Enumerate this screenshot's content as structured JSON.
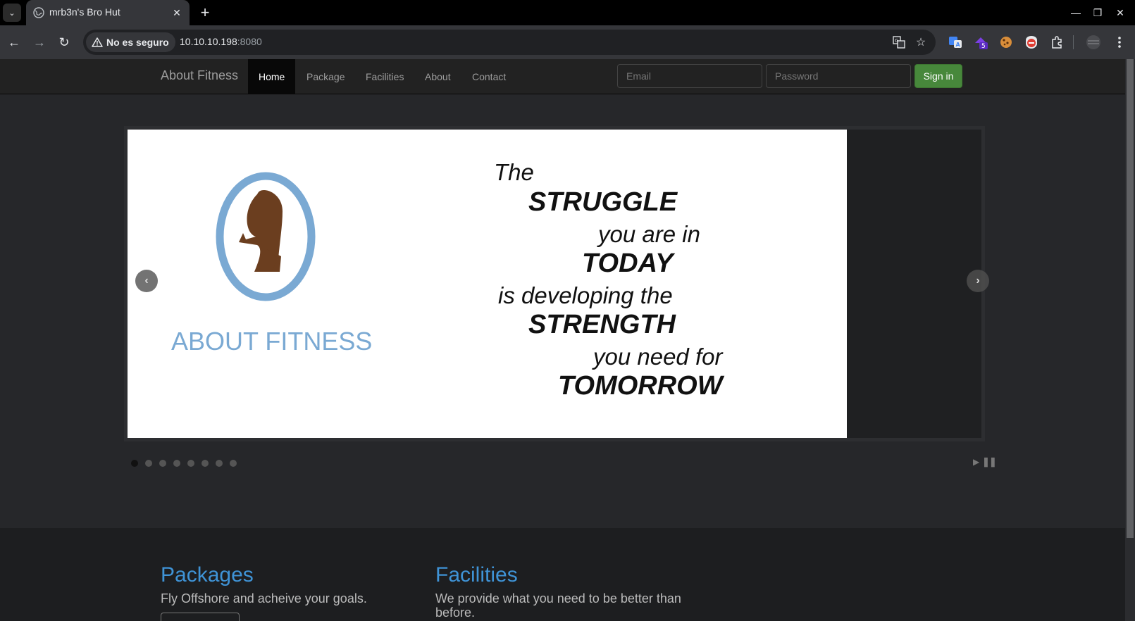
{
  "browser": {
    "tab_title": "mrb3n's Bro Hut",
    "security_label": "No es seguro",
    "url_host": "10.10.10.198",
    "url_port": ":8080",
    "extension_badge": "5"
  },
  "navbar": {
    "brand": "About Fitness",
    "items": [
      {
        "label": "Home",
        "active": true
      },
      {
        "label": "Package",
        "active": false
      },
      {
        "label": "Facilities",
        "active": false
      },
      {
        "label": "About",
        "active": false
      },
      {
        "label": "Contact",
        "active": false
      }
    ],
    "email_placeholder": "Email",
    "password_placeholder": "Password",
    "signin_label": "Sign in"
  },
  "slider": {
    "logo_text": "ABOUT FITNESS",
    "quote_lines": [
      "The",
      "STRUGGLE",
      "you are in",
      "TODAY",
      "is developing the",
      "STRENGTH",
      "you need for",
      "TOMORROW"
    ],
    "dot_count": 8,
    "active_dot": 0
  },
  "sections": {
    "packages": {
      "title": "Packages",
      "text": "Fly Offshore and acheive your goals."
    },
    "facilities": {
      "title": "Facilities",
      "text": "We provide what you need to be better than before."
    }
  },
  "colors": {
    "accent_blue": "#3f93d6",
    "signin_green": "#47883b",
    "logo_blue": "#7aa9d3",
    "figure_brown": "#6b3e1f"
  }
}
